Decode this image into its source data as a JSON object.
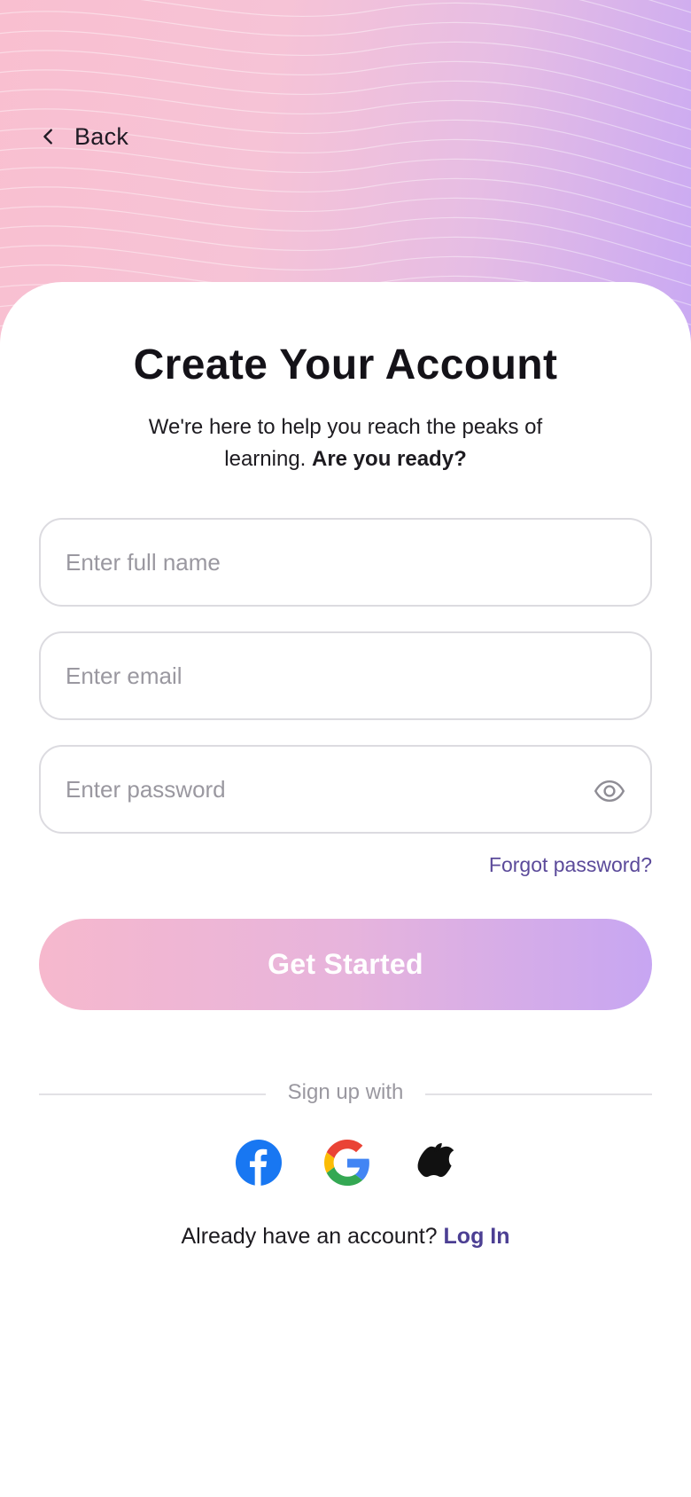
{
  "header": {
    "back_label": "Back"
  },
  "main": {
    "title": "Create Your Account",
    "subtitle_lead": "We're here to help you reach the peaks of learning.",
    "subtitle_emphasis": "Are you ready?"
  },
  "form": {
    "name_placeholder": "Enter full name",
    "name_value": "",
    "email_placeholder": "Enter email",
    "email_value": "",
    "password_placeholder": "Enter password",
    "password_value": "",
    "forgot_label": "Forgot password?",
    "submit_label": "Get Started"
  },
  "social": {
    "divider_label": "Sign up with",
    "providers": [
      {
        "icon": "facebook-icon",
        "color": "#1877f2"
      },
      {
        "icon": "google-icon",
        "color": "#4285f4"
      },
      {
        "icon": "apple-icon",
        "color": "#111111"
      }
    ]
  },
  "footer": {
    "prompt": "Already have an account?",
    "link_label": "Log In"
  },
  "colors": {
    "accent": "#4c3f93",
    "gradient_start": "#f6b8cd",
    "gradient_end": "#c7a6f2"
  }
}
